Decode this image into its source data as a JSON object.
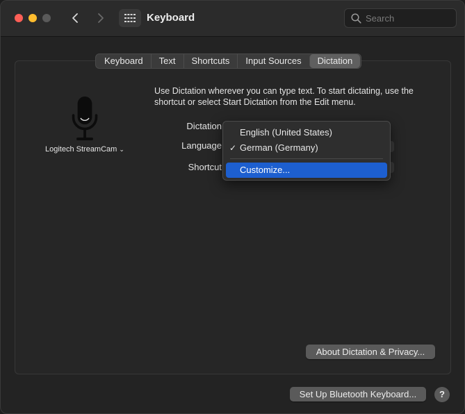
{
  "window": {
    "title": "Keyboard",
    "search_placeholder": "Search"
  },
  "tabs": [
    {
      "label": "Keyboard",
      "active": false
    },
    {
      "label": "Text",
      "active": false
    },
    {
      "label": "Shortcuts",
      "active": false
    },
    {
      "label": "Input Sources",
      "active": false
    },
    {
      "label": "Dictation",
      "active": true
    }
  ],
  "dictation": {
    "microphone": "Logitech StreamCam",
    "description": "Use Dictation wherever you can type text. To start dictating, use the shortcut or select Start Dictation from the Edit menu.",
    "labels": {
      "dictation": "Dictation",
      "language": "Language",
      "shortcut": "Shortcut"
    }
  },
  "language_menu": {
    "items": [
      {
        "label": "English (United States)",
        "checked": false
      },
      {
        "label": "German (Germany)",
        "checked": true
      }
    ],
    "customize_label": "Customize...",
    "check_glyph": "✓"
  },
  "buttons": {
    "privacy": "About Dictation & Privacy...",
    "bluetooth": "Set Up Bluetooth Keyboard...",
    "help": "?"
  },
  "colors": {
    "close": "#fe5f57",
    "minimize": "#febc2e",
    "highlight": "#1d5fcf"
  },
  "icons": {
    "back": "chevron-left-icon",
    "forward": "chevron-right-icon",
    "grid": "grid-icon",
    "search": "search-icon",
    "mic": "microphone-icon"
  }
}
